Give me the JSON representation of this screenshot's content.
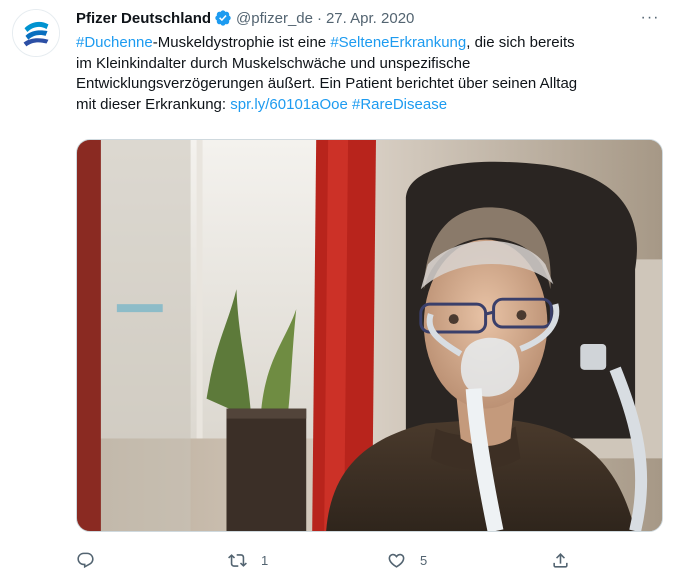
{
  "tweet": {
    "author_name": "Pfizer Deutschland",
    "handle": "@pfizer_de",
    "separator": "·",
    "date": "27. Apr. 2020",
    "more_label": "···",
    "text": {
      "line1": {
        "tag1": "#Duchenne",
        "seg1": "-Muskeldystrophie ist eine ",
        "tag2": "#SelteneErkrankung",
        "seg2": ", die sich bereits"
      },
      "line2": "im Kleinkindalter durch Muskelschwäche und unspezifische",
      "line3": "Entwicklungsverzögerungen äußert. Ein Patient berichtet über seinen Alltag",
      "line4": {
        "seg1": "mit dieser Erkrankung: ",
        "link": "spr.ly/60101aOoe",
        "space": " ",
        "tag3": "#RareDisease"
      }
    },
    "actions": {
      "reply_count": "",
      "retweet_count": "1",
      "like_count": "5",
      "share_count": ""
    }
  },
  "colors": {
    "link": "#1d9bf0",
    "secondary_text": "#536471",
    "verified": "#1d9bf0",
    "brand": "#0093d0"
  },
  "icons": {
    "avatar": "pfizer-logo",
    "verified": "verified-badge-icon",
    "more": "more-icon",
    "reply": "reply-icon",
    "retweet": "retweet-icon",
    "like": "like-icon",
    "share": "share-icon"
  }
}
